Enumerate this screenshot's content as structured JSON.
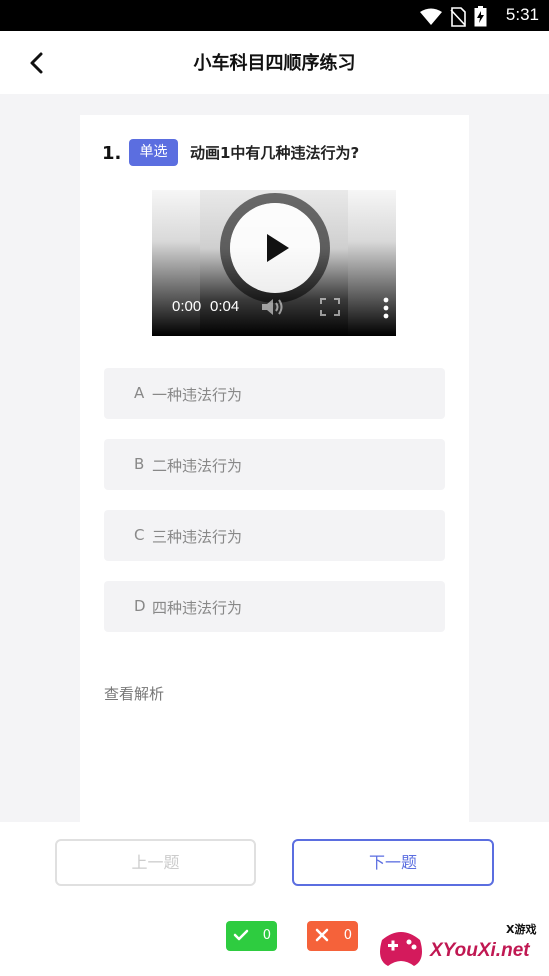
{
  "status_bar": {
    "time": "5:31",
    "icons": [
      "wifi-icon",
      "no-sim-icon",
      "battery-charging-icon"
    ]
  },
  "header": {
    "title": "小车科目四顺序练习",
    "back_icon": "chevron-left-icon"
  },
  "question": {
    "number": "1.",
    "type_badge": "单选",
    "text": "动画1中有几种违法行为?",
    "video": {
      "current_time": "0:00",
      "total_time": "0:04",
      "icons": [
        "play-icon",
        "volume-icon",
        "fullscreen-icon",
        "more-vert-icon"
      ]
    },
    "options": [
      {
        "letter": "A",
        "text": "一种违法行为"
      },
      {
        "letter": "B",
        "text": "二种违法行为"
      },
      {
        "letter": "C",
        "text": "三种违法行为"
      },
      {
        "letter": "D",
        "text": "四种违法行为"
      }
    ],
    "analysis_link": "查看解析"
  },
  "footer": {
    "prev_label": "上一题",
    "next_label": "下一题",
    "correct_count": "0",
    "wrong_count": "0"
  },
  "watermark": {
    "brand": "XYouXi.net",
    "sub": "X游戏"
  },
  "colors": {
    "accent": "#5b6ee0",
    "correct": "#2ecc40",
    "wrong": "#f5623a",
    "option_bg": "#f3f3f5"
  }
}
